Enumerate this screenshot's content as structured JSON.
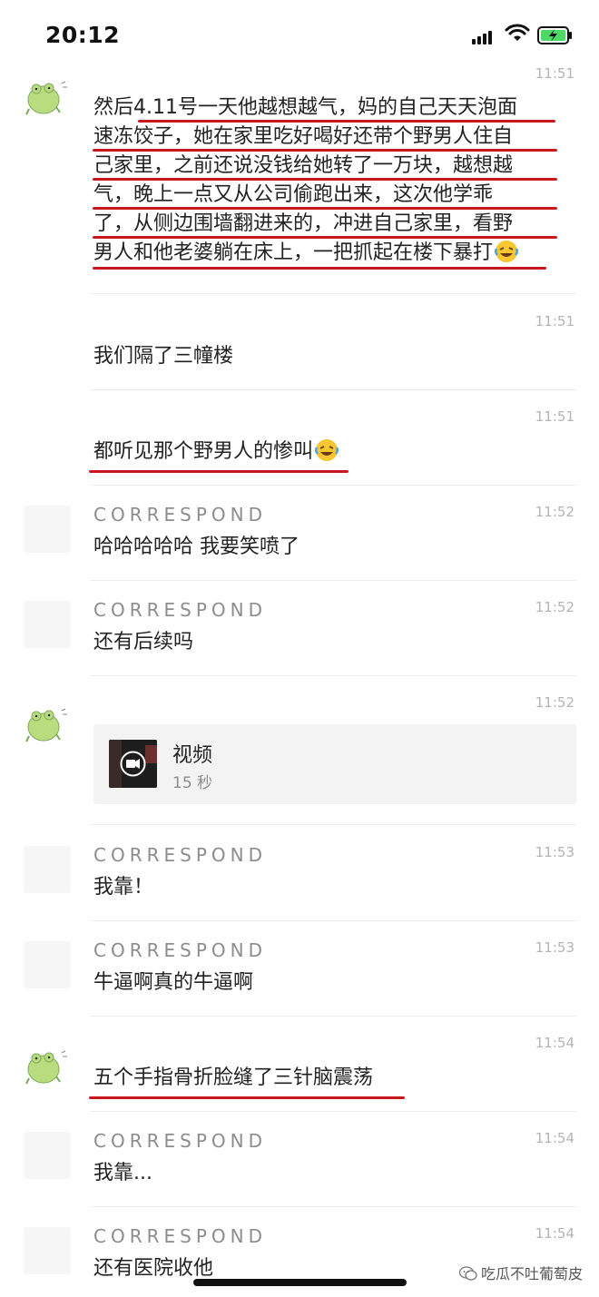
{
  "status_bar": {
    "time": "20:12"
  },
  "messages": [
    {
      "time": "11:51",
      "sender": "",
      "text": "然后4.11号一天他越想越气，妈的自己天天泡面速冻饺子，她在家里吃好喝好还带个野男人住自己家里，之前还说没钱给她转了一万块，越想越气，晚上一点又从公司偷跑出来，这次他学乖了，从侧边围墙翻进来的，冲进自己家里，看野男人和他老婆躺在床上，一把抓起在楼下暴打"
    },
    {
      "time": "11:51",
      "text": "我们隔了三幢楼"
    },
    {
      "time": "11:51",
      "text": "都听见那个野男人的惨叫"
    },
    {
      "time": "11:52",
      "sender": "CORRESPOND",
      "text": "哈哈哈哈哈 我要笑喷了"
    },
    {
      "time": "11:52",
      "sender": "CORRESPOND",
      "text": "还有后续吗"
    },
    {
      "time": "11:52",
      "video": {
        "title": "视频",
        "duration": "15 秒"
      }
    },
    {
      "time": "11:53",
      "sender": "CORRESPOND",
      "text": "我靠！"
    },
    {
      "time": "11:53",
      "sender": "CORRESPOND",
      "text": "牛逼啊真的牛逼啊"
    },
    {
      "time": "11:54",
      "text": "五个手指骨折脸缝了三针脑震荡"
    },
    {
      "time": "11:54",
      "sender": "CORRESPOND",
      "text": "我靠..."
    },
    {
      "time": "11:54",
      "sender": "CORRESPOND",
      "text": "还有医院收他"
    }
  ],
  "first_message_lines": [
    "然后4.11号一天他越想越气，妈的自己天天泡面",
    "速冻饺子，她在家里吃好喝好还带个野男人住自",
    "己家里，之前还说没钱给她转了一万块，越想越",
    "气，晚上一点又从公司偷跑出来，这次他学乖",
    "了，从侧边围墙翻进来的，冲进自己家里，看野",
    "男人和他老婆躺在床上，一把抓起在楼下暴打"
  ],
  "watermark": "吃瓜不吐葡萄皮",
  "colors": {
    "underline": "#c8171e",
    "avatar": "#b8dc7e",
    "meta_text": "#b4b4b4"
  },
  "icons": [
    "signal-icon",
    "wifi-icon",
    "battery-charging-icon",
    "frog-avatar-icon",
    "laughing-crying-emoji-icon",
    "video-camera-icon",
    "wechat-logo-icon"
  ]
}
